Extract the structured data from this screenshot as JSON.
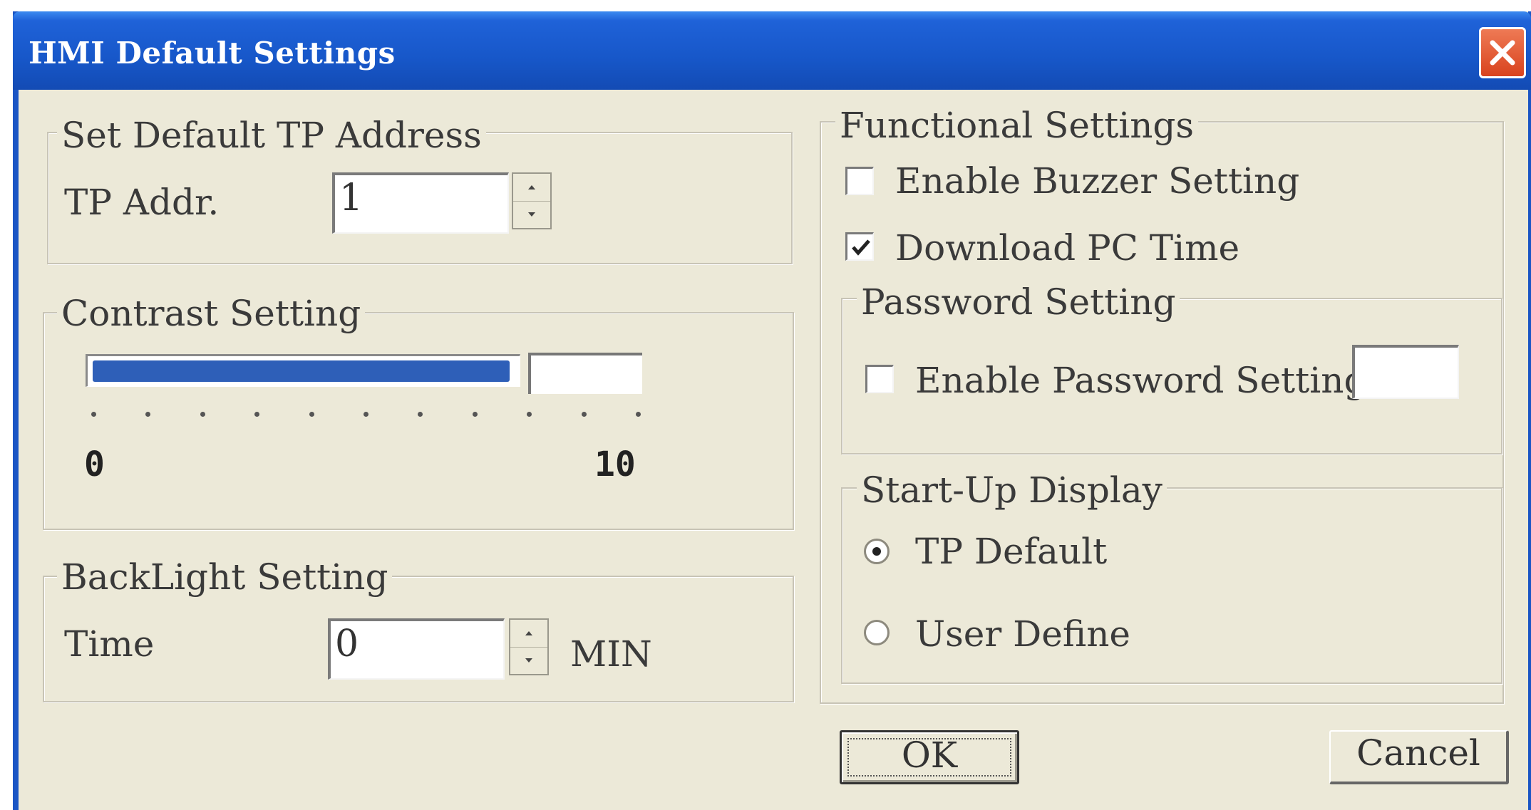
{
  "window": {
    "title": "HMI Default Settings"
  },
  "tp_address": {
    "legend": "Set Default TP Address",
    "label": "TP Addr.",
    "value": "1"
  },
  "contrast": {
    "legend": "Contrast Setting",
    "min_label": "0",
    "max_label": "10",
    "value_fraction": 0.8
  },
  "backlight": {
    "legend": "BackLight Setting",
    "label": "Time",
    "value": "0",
    "unit": "MIN"
  },
  "functional": {
    "legend": "Functional Settings",
    "buzzer": {
      "label": "Enable Buzzer Setting",
      "checked": false
    },
    "pc_time": {
      "label": "Download PC Time",
      "checked": true
    }
  },
  "password": {
    "legend": "Password Setting",
    "enable": {
      "label": "Enable Password Setting",
      "checked": false
    },
    "value": ""
  },
  "startup": {
    "legend": "Start-Up Display",
    "options": [
      {
        "label": "TP Default",
        "selected": true
      },
      {
        "label": "User Define",
        "selected": false
      }
    ]
  },
  "buttons": {
    "ok": "OK",
    "cancel": "Cancel"
  },
  "colors": {
    "titlebar": "#1757c9",
    "dialog_bg": "#ece9d8",
    "slider_fill": "#2e5fb8",
    "close_button": "#d9431e"
  },
  "icons": {
    "close": "close-icon",
    "checkmark": "checkmark-icon",
    "spin_up": "spin-up-arrow-icon",
    "spin_down": "spin-down-arrow-icon"
  }
}
